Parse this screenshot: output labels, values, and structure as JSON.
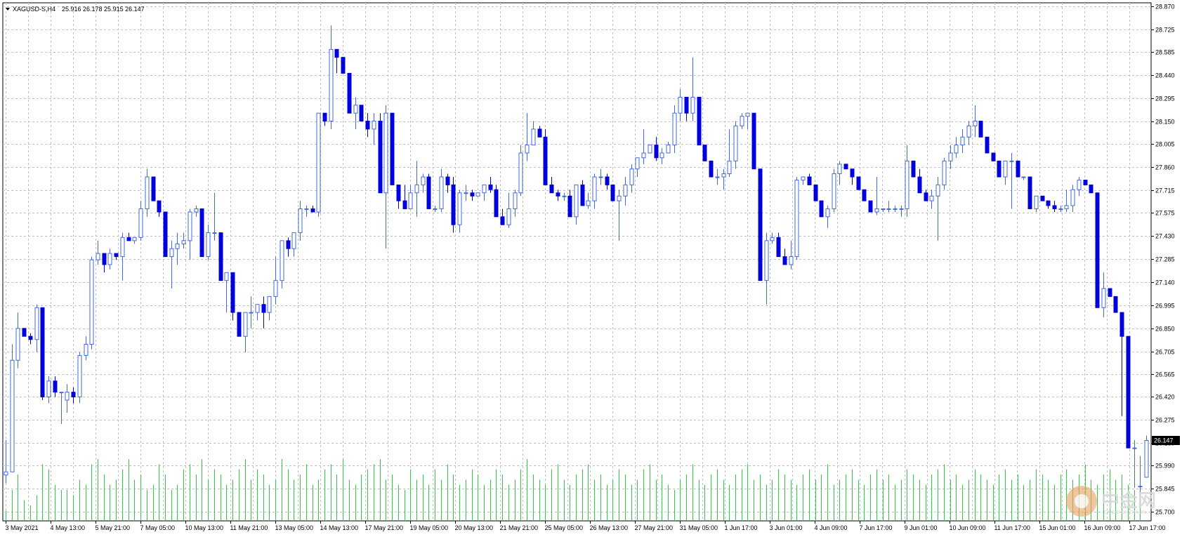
{
  "header": {
    "symbol": "XAGUSD-S,H4",
    "ohlc": "25.916 26.178 25.915 26.147"
  },
  "current_price_label": "26.147",
  "watermark": {
    "cn": "中金网",
    "en": "CNGOLD.COM.CN"
  },
  "colors": {
    "bull": "#4169e1",
    "bear": "#0000dd",
    "volume": "#2ecc40",
    "grid": "#c0c0c0",
    "axis": "#000000",
    "price_tag_bg": "#000000"
  },
  "chart_data": {
    "type": "candlestick",
    "title": "XAGUSD-S,H4",
    "y_axis": {
      "side": "right",
      "ylim": [
        25.7,
        28.87
      ],
      "ticks": [
        28.87,
        28.725,
        28.585,
        28.44,
        28.295,
        28.15,
        28.005,
        27.86,
        27.715,
        27.575,
        27.43,
        27.285,
        27.14,
        26.995,
        26.85,
        26.705,
        26.565,
        26.42,
        26.275,
        26.13,
        25.99,
        25.845,
        25.7
      ],
      "tick_labels": [
        "28.870",
        "28.725",
        "28.585",
        "28.440",
        "28.295",
        "28.150",
        "28.005",
        "27.860",
        "27.715",
        "27.575",
        "27.430",
        "27.285",
        "27.140",
        "26.995",
        "26.850",
        "26.705",
        "26.565",
        "26.420",
        "26.275",
        "26.130",
        "25.990",
        "25.845",
        "25.700"
      ]
    },
    "x_axis": {
      "tick_labels": [
        "3 May 2021",
        "4 May 13:00",
        "5 May 21:00",
        "7 May 05:00",
        "10 May 13:00",
        "11 May 21:00",
        "13 May 05:00",
        "14 May 13:00",
        "17 May 21:00",
        "19 May 05:00",
        "20 May 13:00",
        "21 May 21:00",
        "25 May 05:00",
        "26 May 13:00",
        "27 May 21:00",
        "31 May 05:00",
        "1 Jun 17:00",
        "3 Jun 01:00",
        "4 Jun 09:00",
        "7 Jun 17:00",
        "9 Jun 01:00",
        "10 Jun 09:00",
        "11 Jun 17:00",
        "15 Jun 01:00",
        "16 Jun 09:00",
        "17 Jun 17:00"
      ]
    },
    "grid": true,
    "candles": [
      [
        25.93,
        26.15,
        25.88,
        25.95
      ],
      [
        25.95,
        26.75,
        26.05,
        26.65
      ],
      [
        26.65,
        26.95,
        26.6,
        26.85
      ],
      [
        26.85,
        26.85,
        26.8,
        26.8
      ],
      [
        26.8,
        26.82,
        26.75,
        26.78
      ],
      [
        26.78,
        27.0,
        26.7,
        26.98
      ],
      [
        26.98,
        26.98,
        26.4,
        26.42
      ],
      [
        26.42,
        26.55,
        26.38,
        26.52
      ],
      [
        26.52,
        26.55,
        26.42,
        26.45
      ],
      [
        26.45,
        26.45,
        26.25,
        26.45
      ],
      [
        26.4,
        26.5,
        26.32,
        26.45
      ],
      [
        26.45,
        26.48,
        26.38,
        26.42
      ],
      [
        26.42,
        26.7,
        26.38,
        26.68
      ],
      [
        26.68,
        26.8,
        26.65,
        26.75
      ],
      [
        26.75,
        27.3,
        26.72,
        27.28
      ],
      [
        27.28,
        27.4,
        27.25,
        27.32
      ],
      [
        27.32,
        27.32,
        27.2,
        27.25
      ],
      [
        27.25,
        27.35,
        27.22,
        27.32
      ],
      [
        27.32,
        27.32,
        27.28,
        27.3
      ],
      [
        27.3,
        27.45,
        27.15,
        27.42
      ],
      [
        27.42,
        27.45,
        27.4,
        27.4
      ],
      [
        27.4,
        27.42,
        27.38,
        27.42
      ],
      [
        27.42,
        27.65,
        27.4,
        27.6
      ],
      [
        27.6,
        27.85,
        27.55,
        27.8
      ],
      [
        27.8,
        27.8,
        27.65,
        27.65
      ],
      [
        27.65,
        27.65,
        27.55,
        27.58
      ],
      [
        27.58,
        27.58,
        27.3,
        27.3
      ],
      [
        27.3,
        27.4,
        27.1,
        27.35
      ],
      [
        27.35,
        27.45,
        27.25,
        27.38
      ],
      [
        27.38,
        27.45,
        27.35,
        27.4
      ],
      [
        27.4,
        27.6,
        27.28,
        27.58
      ],
      [
        27.58,
        27.62,
        27.55,
        27.6
      ],
      [
        27.6,
        27.6,
        27.3,
        27.3
      ],
      [
        27.3,
        27.5,
        27.28,
        27.45
      ],
      [
        27.45,
        27.7,
        27.4,
        27.45
      ],
      [
        27.45,
        27.45,
        27.15,
        27.15
      ],
      [
        27.15,
        27.2,
        26.95,
        27.2
      ],
      [
        27.2,
        27.2,
        26.9,
        26.95
      ],
      [
        26.95,
        26.95,
        26.8,
        26.8
      ],
      [
        26.8,
        26.8,
        26.7,
        26.95
      ],
      [
        26.95,
        27.05,
        26.85,
        26.95
      ],
      [
        26.95,
        27.0,
        26.9,
        27.0
      ],
      [
        27.0,
        27.05,
        26.85,
        26.95
      ],
      [
        26.95,
        27.0,
        26.9,
        27.05
      ],
      [
        27.05,
        27.3,
        27.0,
        27.15
      ],
      [
        27.15,
        27.4,
        27.1,
        27.4
      ],
      [
        27.4,
        27.42,
        27.3,
        27.35
      ],
      [
        27.35,
        27.45,
        27.3,
        27.45
      ],
      [
        27.45,
        27.65,
        27.4,
        27.6
      ],
      [
        27.6,
        27.62,
        27.55,
        27.6
      ],
      [
        27.6,
        27.62,
        27.58,
        27.58
      ],
      [
        27.58,
        28.2,
        27.55,
        28.2
      ],
      [
        28.2,
        28.2,
        28.12,
        28.15
      ],
      [
        28.15,
        28.75,
        28.1,
        28.6
      ],
      [
        28.6,
        28.55,
        28.45,
        28.55
      ],
      [
        28.55,
        28.5,
        28.45,
        28.45
      ],
      [
        28.45,
        28.4,
        28.2,
        28.2
      ],
      [
        28.2,
        28.3,
        28.1,
        28.25
      ],
      [
        28.25,
        28.25,
        28.15,
        28.15
      ],
      [
        28.15,
        28.2,
        28.05,
        28.1
      ],
      [
        28.1,
        28.2,
        28.0,
        28.15
      ],
      [
        28.15,
        28.2,
        27.7,
        27.7
      ],
      [
        27.7,
        28.25,
        27.35,
        28.2
      ],
      [
        28.2,
        28.2,
        27.75,
        27.75
      ],
      [
        27.75,
        27.75,
        27.6,
        27.65
      ],
      [
        27.65,
        27.75,
        27.6,
        27.6
      ],
      [
        27.6,
        27.75,
        27.6,
        27.7
      ],
      [
        27.7,
        27.9,
        27.55,
        27.75
      ],
      [
        27.75,
        27.82,
        27.7,
        27.8
      ],
      [
        27.8,
        27.82,
        27.6,
        27.6
      ],
      [
        27.6,
        27.62,
        27.58,
        27.6
      ],
      [
        27.6,
        27.85,
        27.58,
        27.8
      ],
      [
        27.8,
        27.82,
        27.7,
        27.75
      ],
      [
        27.75,
        27.8,
        27.45,
        27.5
      ],
      [
        27.5,
        27.72,
        27.45,
        27.7
      ],
      [
        27.7,
        27.75,
        27.65,
        27.7
      ],
      [
        27.7,
        27.72,
        27.65,
        27.68
      ],
      [
        27.68,
        27.7,
        27.68,
        27.7
      ],
      [
        27.7,
        27.75,
        27.65,
        27.75
      ],
      [
        27.75,
        27.8,
        27.7,
        27.72
      ],
      [
        27.72,
        27.75,
        27.55,
        27.55
      ],
      [
        27.55,
        27.6,
        27.5,
        27.5
      ],
      [
        27.5,
        27.7,
        27.48,
        27.6
      ],
      [
        27.6,
        27.72,
        27.55,
        27.7
      ],
      [
        27.7,
        28.0,
        27.68,
        27.95
      ],
      [
        27.95,
        28.2,
        27.9,
        28.0
      ],
      [
        28.0,
        28.15,
        28.05,
        28.1
      ],
      [
        28.1,
        28.12,
        28.05,
        28.05
      ],
      [
        28.05,
        28.1,
        27.75,
        27.75
      ],
      [
        27.75,
        27.8,
        27.7,
        27.7
      ],
      [
        27.7,
        27.72,
        27.65,
        27.68
      ],
      [
        27.68,
        27.7,
        27.65,
        27.68
      ],
      [
        27.68,
        27.72,
        27.55,
        27.55
      ],
      [
        27.55,
        27.75,
        27.5,
        27.75
      ],
      [
        27.75,
        27.78,
        27.62,
        27.62
      ],
      [
        27.62,
        27.7,
        27.6,
        27.65
      ],
      [
        27.65,
        27.82,
        27.6,
        27.8
      ],
      [
        27.8,
        27.85,
        27.75,
        27.8
      ],
      [
        27.8,
        27.82,
        27.72,
        27.75
      ],
      [
        27.75,
        27.75,
        27.65,
        27.65
      ],
      [
        27.65,
        27.72,
        27.4,
        27.68
      ],
      [
        27.68,
        27.8,
        27.62,
        27.75
      ],
      [
        27.75,
        27.88,
        27.7,
        27.85
      ],
      [
        27.85,
        27.92,
        27.8,
        27.92
      ],
      [
        27.92,
        28.1,
        27.88,
        27.95
      ],
      [
        27.95,
        28.0,
        27.95,
        28.0
      ],
      [
        28.0,
        28.05,
        27.9,
        27.92
      ],
      [
        27.92,
        27.98,
        27.88,
        27.95
      ],
      [
        27.95,
        28.02,
        27.95,
        28.0
      ],
      [
        28.0,
        28.25,
        27.95,
        28.2
      ],
      [
        28.2,
        28.35,
        28.15,
        28.3
      ],
      [
        28.3,
        28.3,
        28.15,
        28.2
      ],
      [
        28.2,
        28.55,
        28.15,
        28.3
      ],
      [
        28.3,
        28.3,
        28.0,
        28.0
      ],
      [
        28.0,
        28.0,
        27.9,
        27.9
      ],
      [
        27.9,
        27.9,
        27.8,
        27.8
      ],
      [
        27.8,
        27.85,
        27.75,
        27.8
      ],
      [
        27.8,
        27.85,
        27.72,
        27.82
      ],
      [
        27.82,
        28.1,
        27.8,
        27.9
      ],
      [
        27.9,
        28.15,
        27.85,
        28.12
      ],
      [
        28.12,
        28.2,
        28.1,
        28.18
      ],
      [
        28.18,
        28.2,
        28.1,
        28.2
      ],
      [
        28.2,
        28.2,
        27.85,
        27.85
      ],
      [
        27.85,
        27.85,
        27.15,
        27.15
      ],
      [
        27.15,
        27.45,
        27.0,
        27.4
      ],
      [
        27.4,
        27.45,
        27.38,
        27.42
      ],
      [
        27.42,
        27.45,
        27.3,
        27.3
      ],
      [
        27.3,
        27.35,
        27.25,
        27.25
      ],
      [
        27.25,
        27.4,
        27.22,
        27.3
      ],
      [
        27.3,
        27.8,
        27.28,
        27.78
      ],
      [
        27.78,
        27.8,
        27.75,
        27.8
      ],
      [
        27.8,
        27.82,
        27.75,
        27.75
      ],
      [
        27.75,
        27.75,
        27.65,
        27.65
      ],
      [
        27.65,
        27.65,
        27.55,
        27.55
      ],
      [
        27.55,
        27.62,
        27.48,
        27.6
      ],
      [
        27.6,
        27.85,
        27.58,
        27.82
      ],
      [
        27.82,
        27.9,
        27.75,
        27.88
      ],
      [
        27.88,
        27.88,
        27.85,
        27.85
      ],
      [
        27.85,
        27.85,
        27.75,
        27.8
      ],
      [
        27.8,
        27.8,
        27.72,
        27.72
      ],
      [
        27.72,
        27.72,
        27.65,
        27.65
      ],
      [
        27.65,
        27.65,
        27.58,
        27.58
      ],
      [
        27.58,
        27.8,
        27.56,
        27.6
      ],
      [
        27.6,
        27.6,
        27.58,
        27.6
      ],
      [
        27.6,
        27.65,
        27.58,
        27.6
      ],
      [
        27.6,
        27.62,
        27.58,
        27.6
      ],
      [
        27.6,
        27.62,
        27.55,
        27.6
      ],
      [
        27.6,
        28.0,
        27.55,
        27.9
      ],
      [
        27.9,
        27.9,
        27.8,
        27.8
      ],
      [
        27.8,
        27.85,
        27.7,
        27.7
      ],
      [
        27.7,
        27.72,
        27.65,
        27.65
      ],
      [
        27.65,
        27.72,
        27.6,
        27.68
      ],
      [
        27.68,
        27.8,
        27.4,
        27.75
      ],
      [
        27.75,
        27.92,
        27.72,
        27.9
      ],
      [
        27.9,
        28.0,
        27.85,
        27.95
      ],
      [
        27.95,
        28.05,
        27.92,
        28.0
      ],
      [
        28.0,
        28.1,
        27.95,
        28.05
      ],
      [
        28.05,
        28.15,
        28.0,
        28.12
      ],
      [
        28.12,
        28.25,
        28.05,
        28.15
      ],
      [
        28.15,
        28.15,
        28.05,
        28.05
      ],
      [
        28.05,
        28.05,
        27.95,
        27.95
      ],
      [
        27.95,
        27.95,
        27.9,
        27.9
      ],
      [
        27.9,
        27.9,
        27.8,
        27.8
      ],
      [
        27.8,
        27.9,
        27.75,
        27.9
      ],
      [
        27.9,
        27.95,
        27.6,
        27.9
      ],
      [
        27.9,
        27.9,
        27.8,
        27.8
      ],
      [
        27.8,
        27.8,
        27.78,
        27.8
      ],
      [
        27.8,
        27.8,
        27.6,
        27.6
      ],
      [
        27.6,
        27.68,
        27.58,
        27.68
      ],
      [
        27.68,
        27.68,
        27.65,
        27.65
      ],
      [
        27.65,
        27.65,
        27.6,
        27.62
      ],
      [
        27.62,
        27.65,
        27.58,
        27.6
      ],
      [
        27.6,
        27.62,
        27.58,
        27.6
      ],
      [
        27.6,
        27.72,
        27.58,
        27.62
      ],
      [
        27.62,
        27.75,
        27.58,
        27.72
      ],
      [
        27.72,
        27.8,
        27.68,
        27.78
      ],
      [
        27.78,
        27.78,
        27.75,
        27.75
      ],
      [
        27.75,
        27.75,
        27.7,
        27.7
      ],
      [
        27.7,
        27.7,
        26.98,
        26.98
      ],
      [
        26.98,
        27.2,
        26.92,
        27.1
      ],
      [
        27.1,
        27.1,
        27.05,
        27.05
      ],
      [
        27.05,
        27.05,
        26.95,
        26.95
      ],
      [
        26.95,
        26.95,
        26.3,
        26.8
      ],
      [
        26.8,
        26.8,
        26.1,
        26.1
      ],
      [
        26.1,
        26.15,
        25.85,
        26.1
      ],
      [
        25.86,
        26.05,
        25.8,
        25.86
      ],
      [
        25.916,
        26.178,
        25.915,
        26.147
      ]
    ],
    "volume": [
      10,
      30,
      45,
      20,
      15,
      25,
      55,
      50,
      35,
      30,
      30,
      25,
      40,
      35,
      55,
      60,
      45,
      35,
      40,
      50,
      60,
      40,
      45,
      30,
      35,
      55,
      45,
      30,
      35,
      50,
      55,
      45,
      60,
      40,
      50,
      45,
      35,
      40,
      50,
      60,
      40,
      50,
      45,
      35,
      40,
      60,
      50,
      40,
      45,
      55,
      35,
      40,
      50,
      55,
      45,
      60,
      40,
      35,
      45,
      50,
      55,
      60,
      40,
      45,
      35,
      30,
      50,
      40,
      45,
      35,
      50,
      40,
      55,
      45,
      35,
      40,
      50,
      45,
      35,
      40,
      50,
      45,
      35,
      40,
      50,
      60,
      45,
      40,
      35,
      50,
      55,
      40,
      35,
      45,
      50,
      55,
      40,
      45,
      35,
      40,
      50,
      45,
      35,
      40,
      50,
      55,
      40,
      45,
      35,
      30,
      40,
      45,
      55,
      40,
      35,
      45,
      50,
      40,
      35,
      45,
      50,
      55,
      40,
      45,
      35,
      40,
      50,
      45,
      40,
      35,
      45,
      50,
      40,
      45,
      55,
      35,
      40,
      45,
      50,
      40,
      35,
      45,
      50,
      40,
      45,
      35,
      40,
      50,
      45,
      40,
      35,
      45,
      50,
      55,
      40,
      45,
      35,
      40,
      50,
      45,
      40,
      35,
      45,
      50,
      40,
      45,
      35,
      40,
      50,
      45,
      40,
      35,
      45,
      50,
      40,
      45,
      55,
      40,
      35,
      45,
      50,
      40,
      45,
      35,
      30,
      40
    ]
  }
}
